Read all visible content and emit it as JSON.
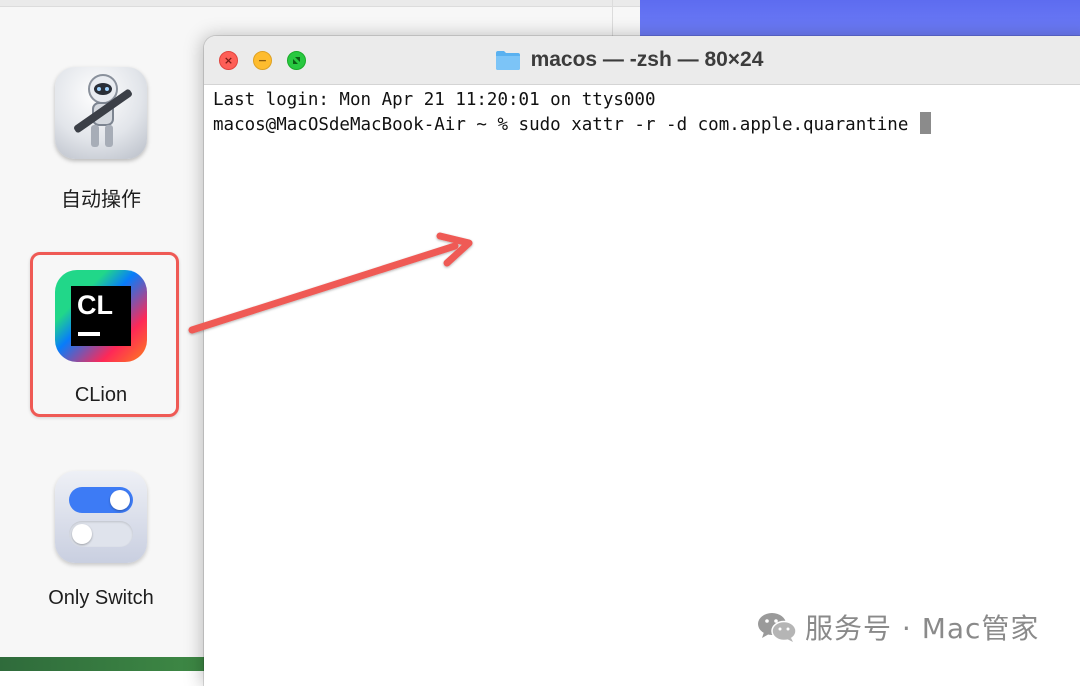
{
  "finder": {
    "apps": [
      {
        "label": "自动操作",
        "icon": "automator-icon"
      },
      {
        "label": "CLion",
        "icon": "clion-icon",
        "icon_text": "CL",
        "highlighted": true
      },
      {
        "label": "Only Switch",
        "icon": "only-switch-icon"
      }
    ]
  },
  "terminal": {
    "title": "macos — -zsh — 80×24",
    "lines": [
      "Last login: Mon Apr 21 11:20:01 on ttys000",
      "macos@MacOSdeMacBook-Air ~ % sudo xattr -r -d com.apple.quarantine "
    ]
  },
  "annotation": {
    "arrow_color": "#ef5a55",
    "box_color": "#ef5a55"
  },
  "watermark": {
    "text": "服务号 · Mac管家"
  }
}
